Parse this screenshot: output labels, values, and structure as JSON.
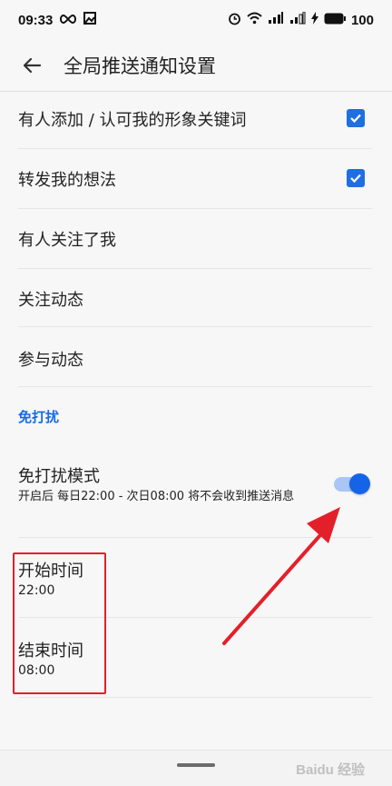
{
  "status_bar": {
    "time": "09:33",
    "battery": "100",
    "icons": [
      "infinity-icon",
      "photo-icon",
      "alarm-icon",
      "wifi-icon",
      "signal-icon",
      "signal-2-icon",
      "charging-icon",
      "battery-icon"
    ]
  },
  "app_bar": {
    "back_icon": "arrow-left-icon",
    "title": "全局推送通知设置"
  },
  "settings": [
    {
      "label": "有人添加 / 认可我的形象关键词",
      "checked": true
    },
    {
      "label": "转发我的想法",
      "checked": true
    },
    {
      "label": "有人关注了我"
    },
    {
      "label": "关注动态"
    },
    {
      "label": "参与动态"
    }
  ],
  "dnd": {
    "section_header": "免打扰",
    "mode_label": "免打扰模式",
    "mode_desc": "开启后 每日22:00 - 次日08:00 将不会收到推送消息",
    "mode_enabled": true,
    "start_label": "开始时间",
    "start_value": "22:00",
    "end_label": "结束时间",
    "end_value": "08:00"
  },
  "colors": {
    "accent": "#1564e8",
    "annotation": "#e3202a"
  },
  "watermark": "Baidu 经验"
}
